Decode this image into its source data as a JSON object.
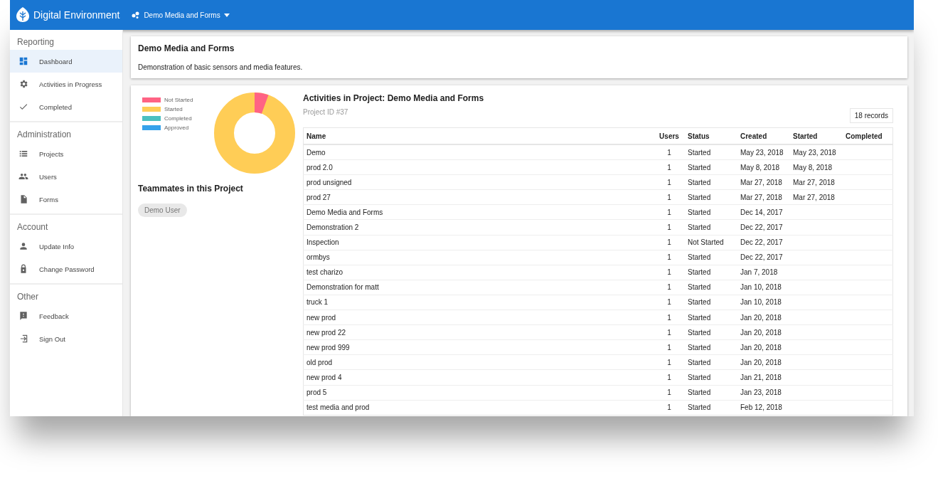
{
  "header": {
    "brand": "Digital Environment",
    "project_menu": "Demo Media and Forms"
  },
  "sidebar": [
    {
      "title": "Reporting",
      "items": [
        {
          "label": "Dashboard",
          "kind": "dashboard",
          "selected": true
        },
        {
          "label": "Activities in Progress",
          "kind": "gear",
          "selected": false
        },
        {
          "label": "Completed",
          "kind": "check",
          "selected": false
        }
      ]
    },
    {
      "title": "Administration",
      "items": [
        {
          "label": "Projects",
          "kind": "list",
          "selected": false
        },
        {
          "label": "Users",
          "kind": "people",
          "selected": false
        },
        {
          "label": "Forms",
          "kind": "file",
          "selected": false
        }
      ]
    },
    {
      "title": "Account",
      "items": [
        {
          "label": "Update Info",
          "kind": "person",
          "selected": false
        },
        {
          "label": "Change Password",
          "kind": "lock",
          "selected": false
        }
      ]
    },
    {
      "title": "Other",
      "items": [
        {
          "label": "Feedback",
          "kind": "feedback",
          "selected": false
        },
        {
          "label": "Sign Out",
          "kind": "signout",
          "selected": false
        }
      ]
    }
  ],
  "project": {
    "title": "Demo Media and Forms",
    "description": "Demonstration of basic sensors and media features."
  },
  "legend": [
    {
      "label": "Not Started",
      "color": "#ff6384"
    },
    {
      "label": "Started",
      "color": "#ffcd56"
    },
    {
      "label": "Completed",
      "color": "#4bc0c0"
    },
    {
      "label": "Approved",
      "color": "#36a2eb"
    }
  ],
  "teammates": {
    "title": "Teammates in this Project",
    "members": [
      "Demo User"
    ]
  },
  "activities": {
    "title": "Activities in Project: Demo Media and Forms",
    "project_id": "Project ID #37",
    "records": "18 records",
    "columns": [
      "Name",
      "Users",
      "Status",
      "Created",
      "Started",
      "Completed"
    ],
    "rows": [
      [
        "Demo",
        "1",
        "Started",
        "May 23, 2018",
        "May 23, 2018"
      ],
      [
        "prod 2.0",
        "1",
        "Started",
        "May 8, 2018",
        "May 8, 2018"
      ],
      [
        "prod unsigned",
        "1",
        "Started",
        "Mar 27, 2018",
        "Mar 27, 2018"
      ],
      [
        "prod 27",
        "1",
        "Started",
        "Mar 27, 2018",
        "Mar 27, 2018"
      ],
      [
        "Demo Media and Forms",
        "1",
        "Started",
        "Dec 14, 2017"
      ],
      [
        "Demonstration 2",
        "1",
        "Started",
        "Dec 22, 2017"
      ],
      [
        "Inspection",
        "1",
        "Not Started",
        "Dec 22, 2017"
      ],
      [
        "ormbys",
        "1",
        "Started",
        "Dec 22, 2017"
      ],
      [
        "test charizo",
        "1",
        "Started",
        "Jan 7, 2018"
      ],
      [
        "Demonstration for matt",
        "1",
        "Started",
        "Jan 10, 2018"
      ],
      [
        "truck 1",
        "1",
        "Started",
        "Jan 10, 2018"
      ],
      [
        "new prod",
        "1",
        "Started",
        "Jan 20, 2018"
      ],
      [
        "new prod 22",
        "1",
        "Started",
        "Jan 20, 2018"
      ],
      [
        "new prod 999",
        "1",
        "Started",
        "Jan 20, 2018"
      ],
      [
        "old prod",
        "1",
        "Started",
        "Jan 20, 2018"
      ],
      [
        "new prod 4",
        "1",
        "Started",
        "Jan 21, 2018"
      ],
      [
        "prod 5",
        "1",
        "Started",
        "Jan 23, 2018"
      ],
      [
        "test media and prod",
        "1",
        "Started",
        "Feb 12, 2018"
      ]
    ]
  }
}
